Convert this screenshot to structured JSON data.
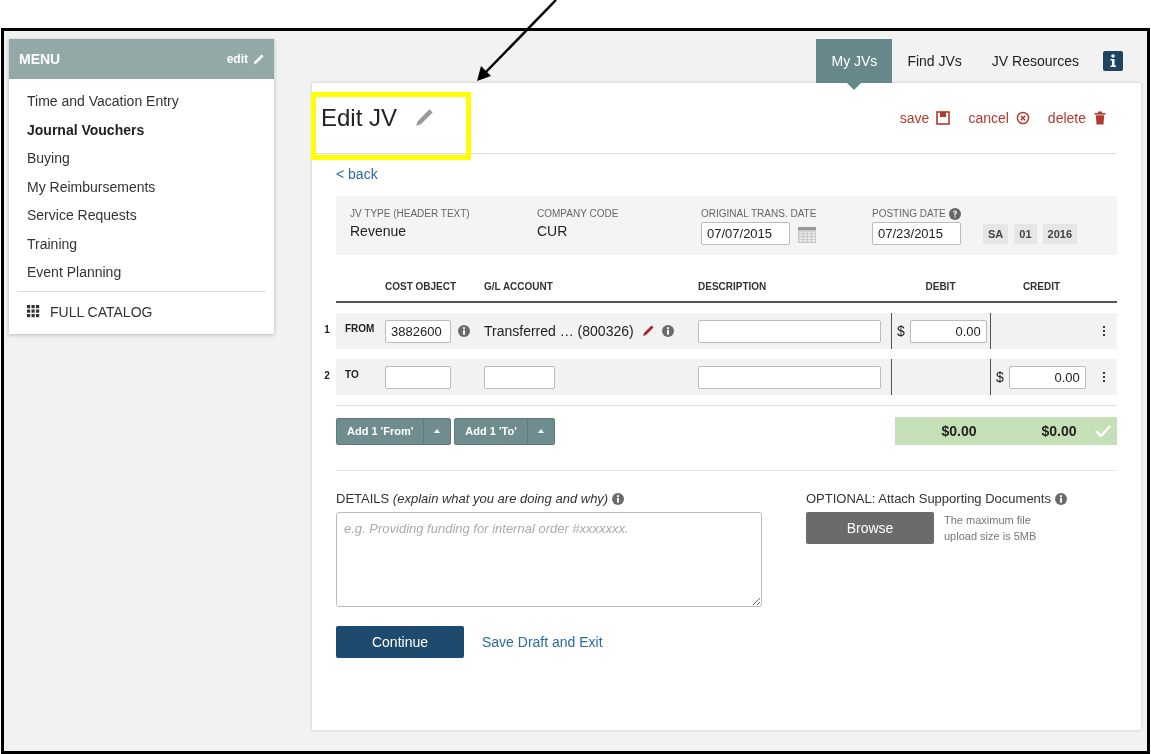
{
  "menu": {
    "title": "MENU",
    "edit_label": "edit",
    "items": [
      {
        "label": "Time and Vacation Entry",
        "selected": false
      },
      {
        "label": "Journal Vouchers",
        "selected": true
      },
      {
        "label": "Buying",
        "selected": false
      },
      {
        "label": "My Reimbursements",
        "selected": false
      },
      {
        "label": "Service Requests",
        "selected": false
      },
      {
        "label": "Training",
        "selected": false
      },
      {
        "label": "Event Planning",
        "selected": false
      }
    ],
    "catalog_label": "FULL CATALOG"
  },
  "tabs": [
    {
      "label": "My JVs",
      "selected": true
    },
    {
      "label": "Find JVs",
      "selected": false
    },
    {
      "label": "JV Resources",
      "selected": false
    }
  ],
  "page": {
    "title": "Edit JV",
    "actions": [
      {
        "label": "save",
        "kind": "save"
      },
      {
        "label": "cancel",
        "kind": "cancel"
      },
      {
        "label": "delete",
        "kind": "delete"
      }
    ],
    "back_link": "< back"
  },
  "header_fields": {
    "jv_type": {
      "label": "JV TYPE (HEADER TEXT)",
      "value": "Revenue"
    },
    "company_code": {
      "label": "COMPANY CODE",
      "value": "CUR"
    },
    "original_trans_date": {
      "label": "ORIGINAL TRANS. DATE",
      "value": "07/07/2015"
    },
    "posting_date": {
      "label": "POSTING DATE",
      "value": "07/23/2015"
    },
    "period": [
      "SA",
      "01",
      "2016"
    ]
  },
  "lines": {
    "columns": [
      "COST OBJECT",
      "G/L ACCOUNT",
      "DESCRIPTION",
      "DEBIT",
      "CREDIT"
    ],
    "rows": [
      {
        "number": "1",
        "direction": "FROM",
        "cost_object": "3882600",
        "gl_account": "Transferred … (800326)",
        "currency": "$",
        "debit": "0.00"
      },
      {
        "number": "2",
        "direction": "TO",
        "currency": "$",
        "credit": "0.00"
      }
    ],
    "add_buttons": [
      "Add 1 'From'",
      "Add 1 'To'"
    ],
    "totals": {
      "debit": "$0.00",
      "credit": "$0.00",
      "balanced": true
    }
  },
  "details": {
    "label": "DETAILS *(explain what you are doing and why)*",
    "placeholder": "e.g. Providing funding for internal order #xxxxxxx."
  },
  "attachments": {
    "label": "OPTIONAL: Attach Supporting Documents",
    "button": "Browse",
    "note": "The maximum file upload size is 5MB"
  },
  "footer": {
    "continue": "Continue",
    "save_draft": "Save Draft and Exit"
  }
}
